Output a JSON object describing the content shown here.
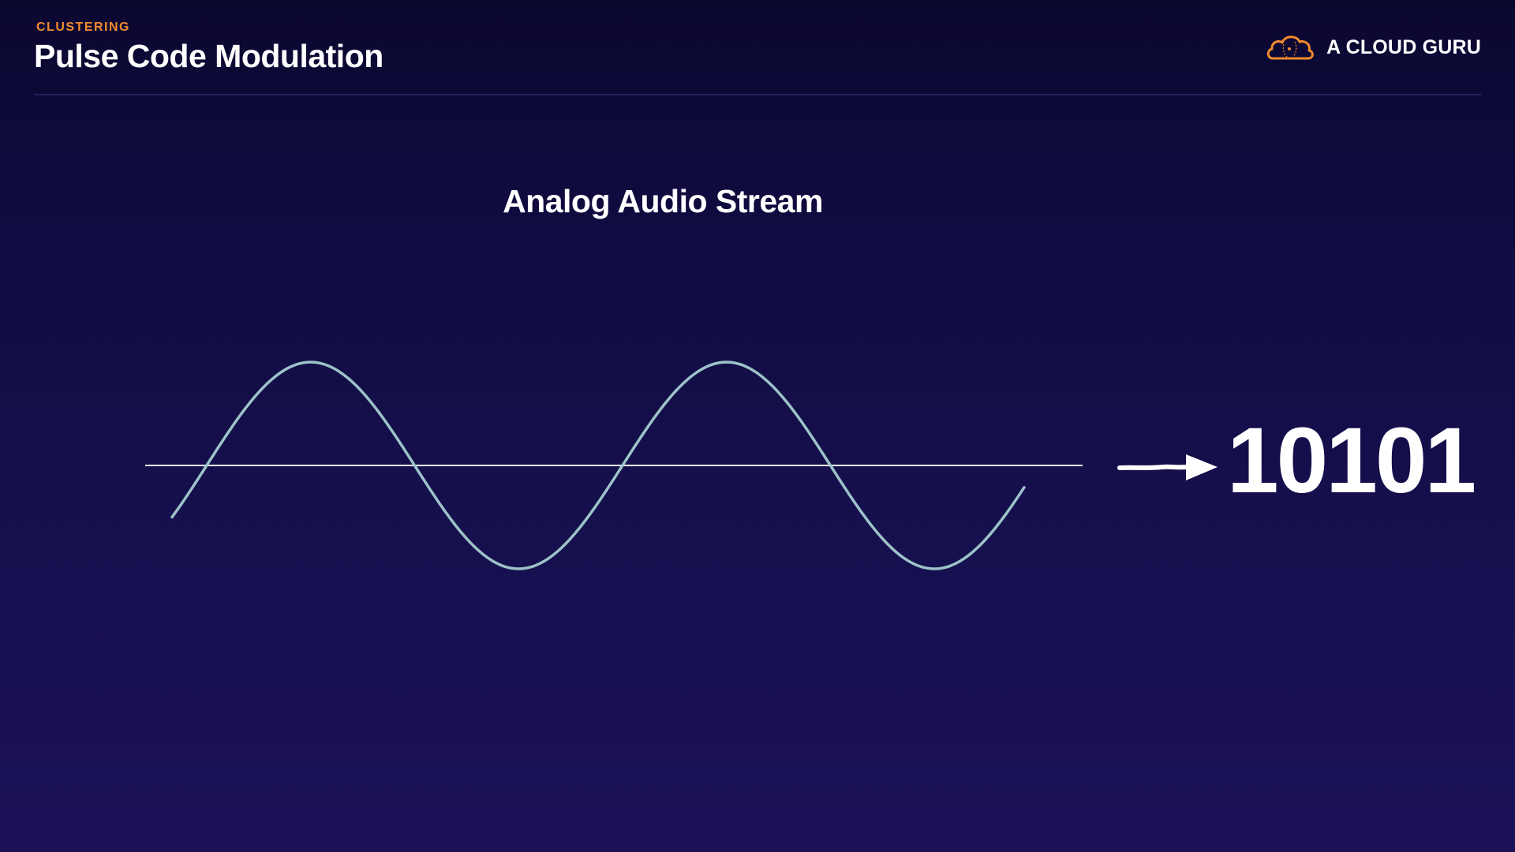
{
  "slide": {
    "category": "CLUSTERING",
    "title": "Pulse Code Modulation"
  },
  "brand": {
    "name": "A CLOUD GURU",
    "logo_icon": "cloud-logo-icon",
    "accent_color": "#f28a2e"
  },
  "diagram": {
    "title": "Analog Audio Stream",
    "wave_icon": "sine-wave",
    "wave_color": "#9cc4c8",
    "arrow_icon": "right-arrow-icon",
    "output": "10101"
  }
}
